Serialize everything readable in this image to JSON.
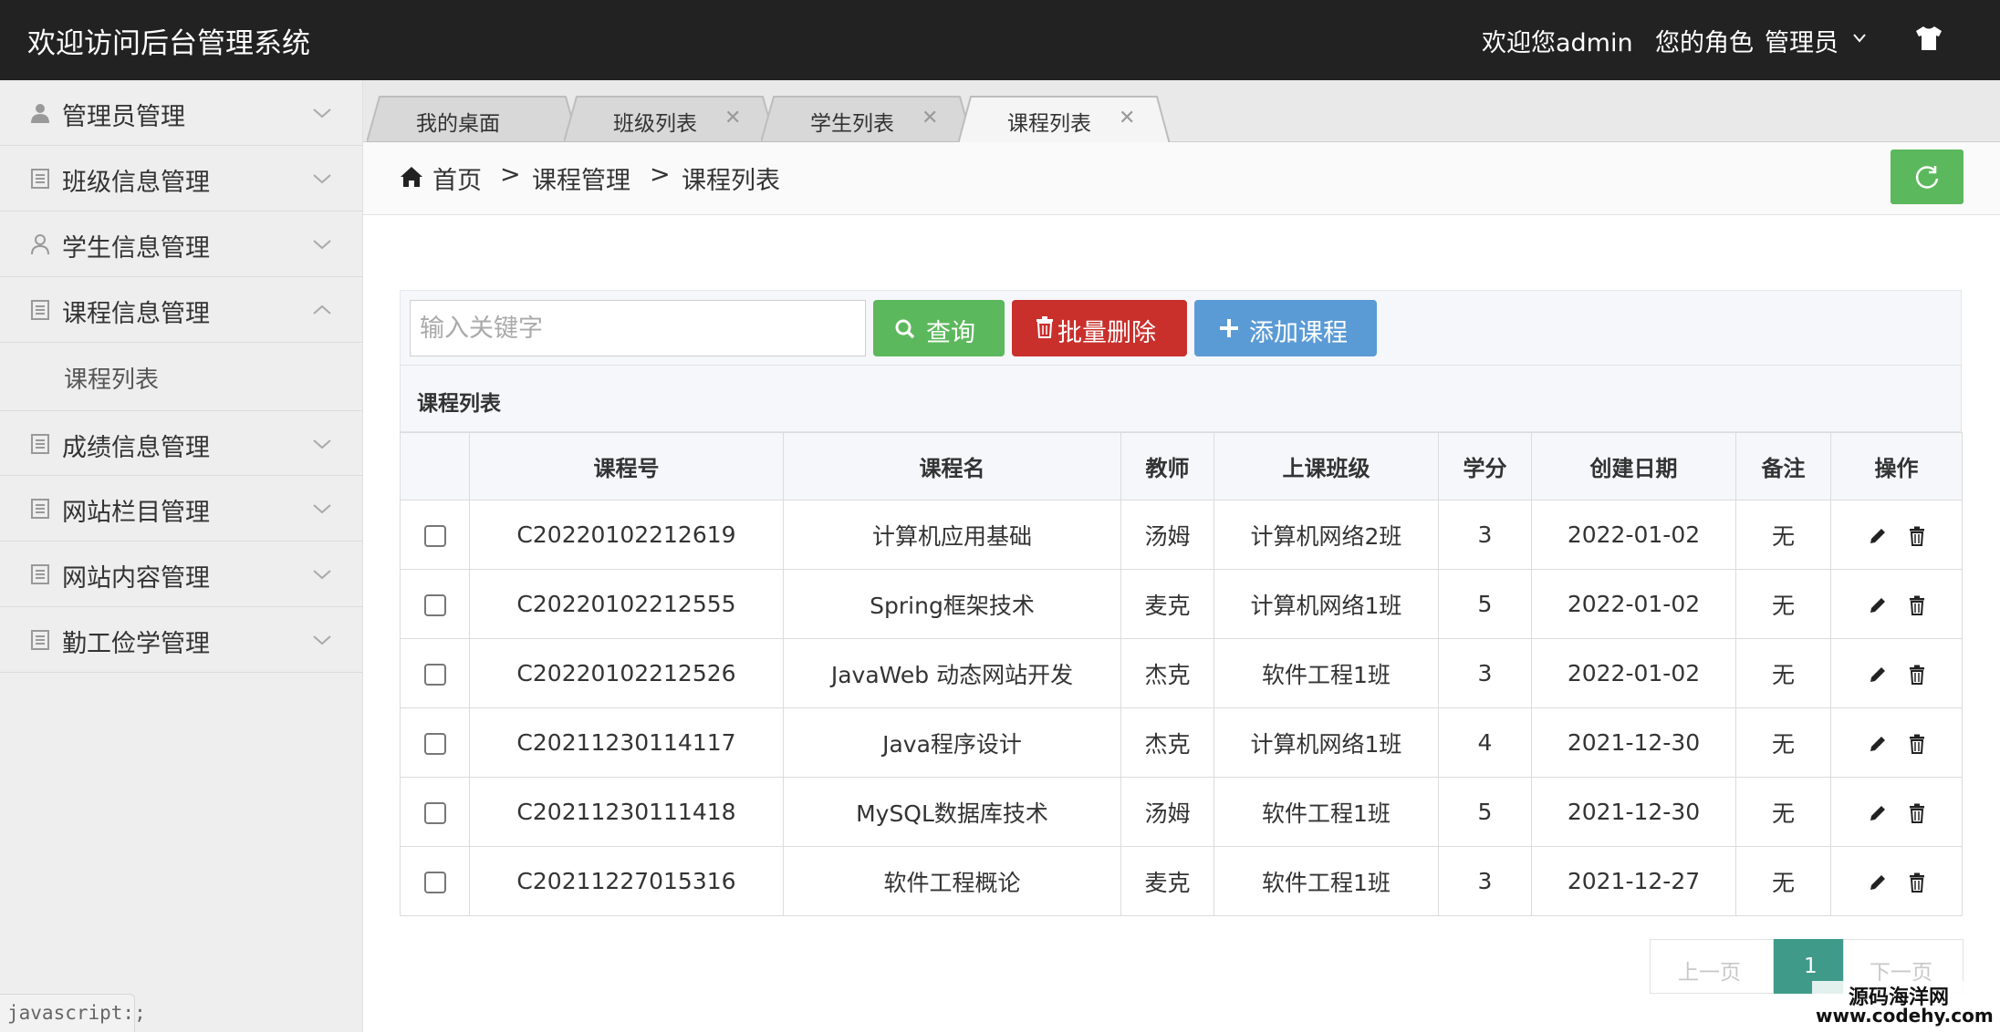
{
  "header": {
    "app_title": "欢迎访问后台管理系统",
    "welcome": "欢迎您admin",
    "role_label": "您的角色",
    "role_value": "管理员"
  },
  "sidebar": {
    "items": [
      {
        "label": "管理员管理",
        "icon": "user-icon"
      },
      {
        "label": "班级信息管理",
        "icon": "list-icon"
      },
      {
        "label": "学生信息管理",
        "icon": "person-outline-icon"
      },
      {
        "label": "课程信息管理",
        "icon": "list-icon",
        "expanded": true
      },
      {
        "label": "成绩信息管理",
        "icon": "list-icon"
      },
      {
        "label": "网站栏目管理",
        "icon": "list-icon"
      },
      {
        "label": "网站内容管理",
        "icon": "list-icon"
      },
      {
        "label": "勤工俭学管理",
        "icon": "list-icon"
      }
    ],
    "sub_items": [
      "课程列表"
    ]
  },
  "tabs": [
    {
      "label": "我的桌面",
      "closable": false
    },
    {
      "label": "班级列表",
      "closable": true
    },
    {
      "label": "学生列表",
      "closable": true
    },
    {
      "label": "课程列表",
      "closable": true,
      "active": true
    }
  ],
  "tab_close_glyph": "✕",
  "breadcrumb": {
    "home": "首页",
    "sep": ">",
    "level1": "课程管理",
    "level2": "课程列表"
  },
  "toolbar": {
    "search_placeholder": "输入关键字",
    "search_label": "查询",
    "batch_delete_label": "批量删除",
    "add_label": "添加课程"
  },
  "panel_title": "课程列表",
  "table": {
    "headers": [
      "课程号",
      "课程名",
      "教师",
      "上课班级",
      "学分",
      "创建日期",
      "备注",
      "操作"
    ],
    "rows": [
      [
        "C20220102212619",
        "计算机应用基础",
        "汤姆",
        "计算机网络2班",
        "3",
        "2022-01-02",
        "无"
      ],
      [
        "C20220102212555",
        "Spring框架技术",
        "麦克",
        "计算机网络1班",
        "5",
        "2022-01-02",
        "无"
      ],
      [
        "C20220102212526",
        "JavaWeb 动态网站开发",
        "杰克",
        "软件工程1班",
        "3",
        "2022-01-02",
        "无"
      ],
      [
        "C20211230114117",
        "Java程序设计",
        "杰克",
        "计算机网络1班",
        "4",
        "2021-12-30",
        "无"
      ],
      [
        "C20211230111418",
        "MySQL数据库技术",
        "汤姆",
        "软件工程1班",
        "5",
        "2021-12-30",
        "无"
      ],
      [
        "C20211227015316",
        "软件工程概论",
        "麦克",
        "软件工程1班",
        "3",
        "2021-12-27",
        "无"
      ]
    ]
  },
  "pagination": {
    "prev": "上一页",
    "current": "1",
    "next": "下一页"
  },
  "status_tip": "javascript:;",
  "watermark": {
    "line1": "源码海洋网",
    "line2": "www.codehy.com"
  },
  "colors": {
    "header_bg": "#222222",
    "success": "#5cb85c",
    "danger": "#c9302c",
    "primary": "#5b9bd5",
    "pager_active": "#3f9a8a"
  }
}
